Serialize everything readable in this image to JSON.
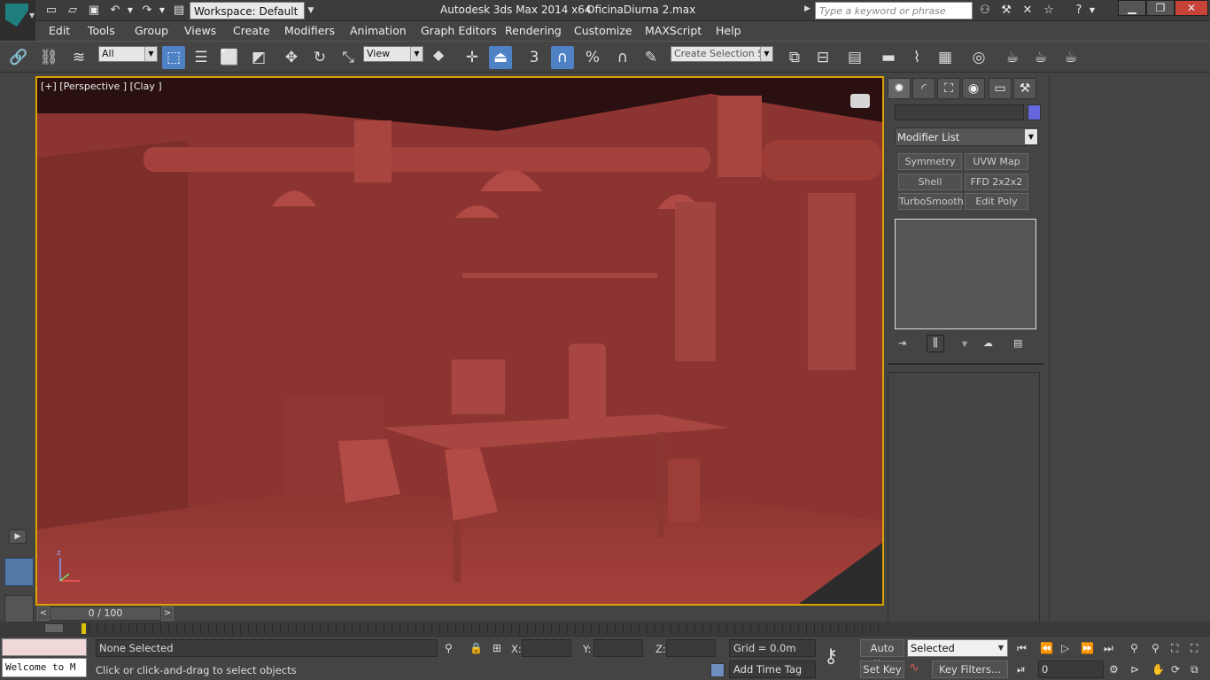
{
  "titlebar": {
    "workspace": "Workspace: Default",
    "app_title": "Autodesk 3ds Max  2014 x64",
    "doc_title": "OficinaDiurna 2.max",
    "search_placeholder": "Type a keyword or phrase"
  },
  "menu": [
    "Edit",
    "Tools",
    "Group",
    "Views",
    "Create",
    "Modifiers",
    "Animation",
    "Graph Editors",
    "Rendering",
    "Customize",
    "MAXScript",
    "Help"
  ],
  "toolbar": {
    "filter": "All",
    "ref_coord": "View",
    "selection_set": "Create Selection Se",
    "snap_label": "3"
  },
  "viewport": {
    "label": "[+] [Perspective ] [Clay ]",
    "axis_z": "z"
  },
  "command_panel": {
    "modifier_list": "Modifier List",
    "modifiers": [
      "Symmetry",
      "UVW Map",
      "Shell",
      "FFD 2x2x2",
      "TurboSmooth",
      "Edit Poly"
    ]
  },
  "timeline": {
    "frame": "0 / 100",
    "prev": "<",
    "next": ">"
  },
  "status": {
    "selection": "None Selected",
    "prompt": "Click or click-and-drag to select objects",
    "x_label": "X:",
    "y_label": "Y:",
    "z_label": "Z:",
    "grid": "Grid = 0.0m",
    "add_time_tag": "Add Time Tag",
    "auto_key": "Auto Key",
    "set_key": "Set Key",
    "key_mode": "Selected",
    "key_filters": "Key Filters...",
    "frame_value": "0",
    "maxscript": "Welcome to M"
  },
  "colors": {
    "accent": "#4f82c5",
    "viewport_border": "#d9a400",
    "clay": "#9b3a36"
  }
}
